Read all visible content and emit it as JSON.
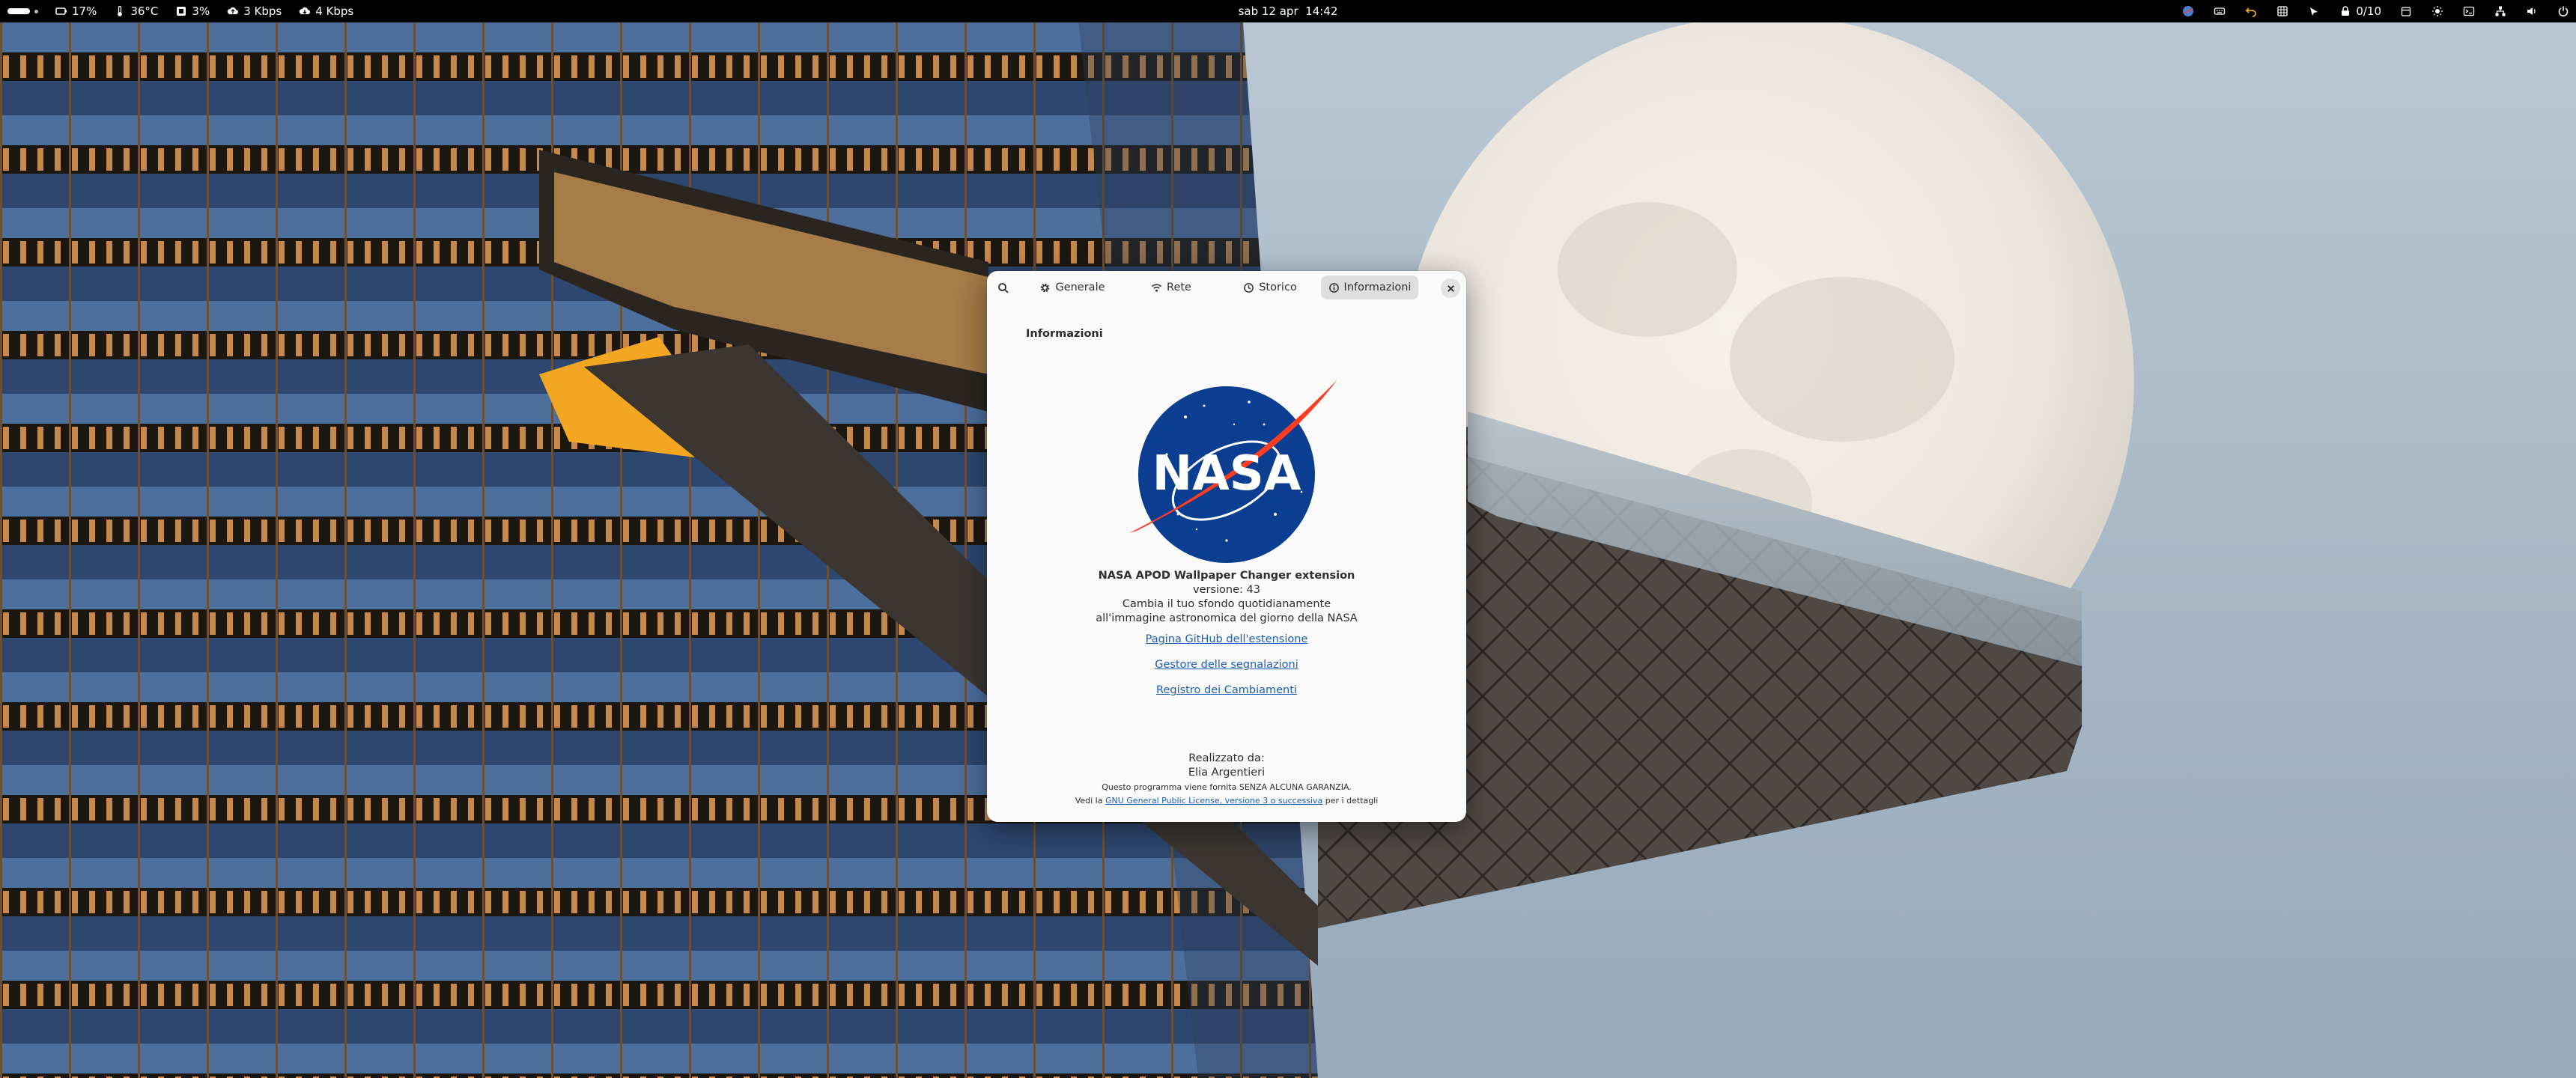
{
  "topbar": {
    "status": [
      {
        "icon": "battery-icon",
        "label": "17%"
      },
      {
        "icon": "thermometer-icon",
        "label": "36°C"
      },
      {
        "icon": "cpu-icon",
        "label": "3%"
      },
      {
        "icon": "upload-icon",
        "label": "3 Kbps"
      },
      {
        "icon": "download-icon",
        "label": "4 Kbps"
      }
    ],
    "clock": "sab 12 apr  14:42",
    "tray_counter": "0/10"
  },
  "dialog": {
    "tabs": [
      {
        "label": "Generale",
        "icon": "gear-icon"
      },
      {
        "label": "Rete",
        "icon": "wifi-icon"
      },
      {
        "label": "Storico",
        "icon": "history-icon"
      },
      {
        "label": "Informazioni",
        "icon": "info-icon",
        "active": true
      }
    ],
    "section_title": "Informazioni",
    "logo_text": "NASA",
    "extension_name": "NASA APOD Wallpaper Changer extension",
    "version": "versione: 43",
    "description_line1": "Cambia il tuo sfondo quotidianamente",
    "description_line2": "all'immagine astronomica del giorno della NASA",
    "links": {
      "github": "Pagina GitHub dell'estensione",
      "issues": "Gestore delle segnalazioni",
      "changelog": "Registro dei Cambiamenti"
    },
    "credits_label": "Realizzato da:",
    "author": "Elia Argentieri",
    "warranty": "Questo programma viene fornita SENZA ALCUNA GARANZIA.",
    "license_prefix": "Vedi la ",
    "license_link": "GNU General Public License, versione 3 o successiva",
    "license_suffix": " per i dettagli"
  },
  "colors": {
    "link": "#1a5fb4",
    "nasa_blue": "#0b3d91",
    "nasa_red": "#fc3d21",
    "topbar": "#000000",
    "dialog_bg": "#fafafa"
  }
}
